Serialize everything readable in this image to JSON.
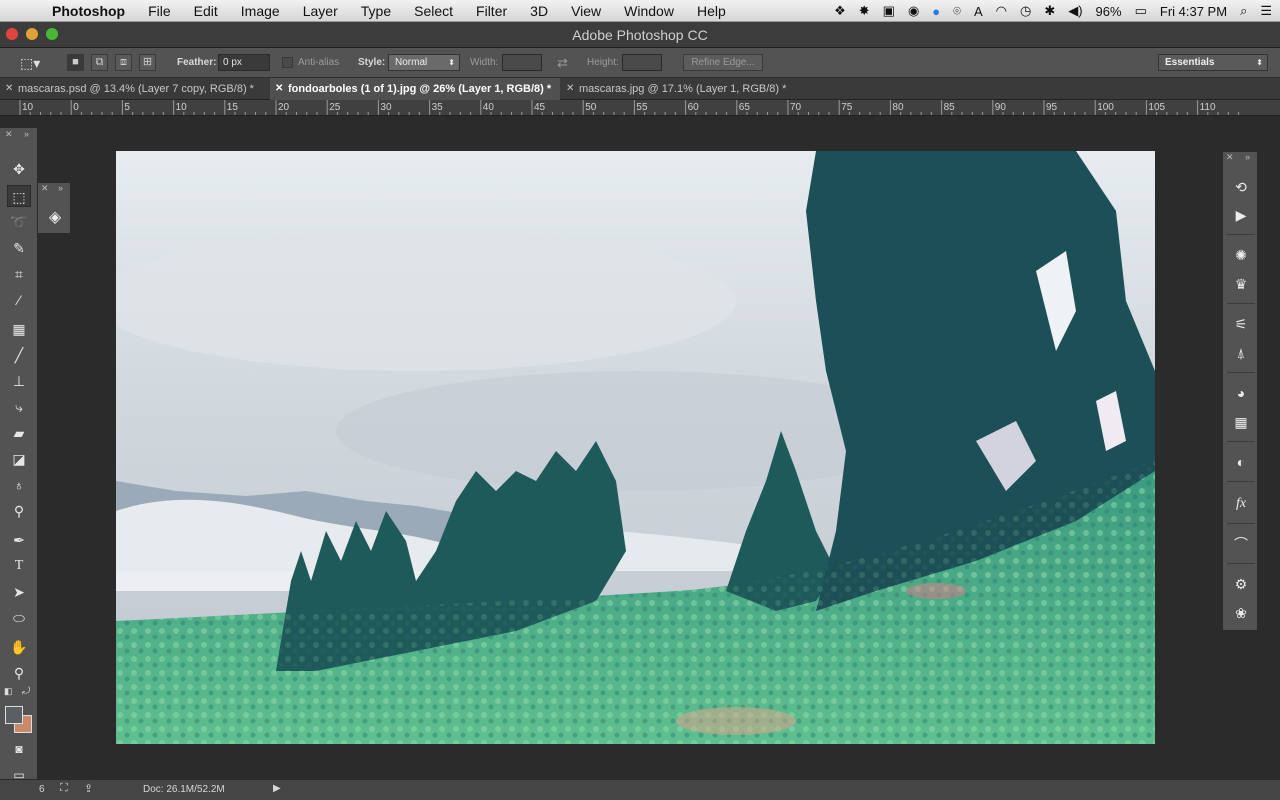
{
  "menubar": {
    "app": "Photoshop",
    "items": [
      "File",
      "Edit",
      "Image",
      "Layer",
      "Type",
      "Select",
      "Filter",
      "3D",
      "View",
      "Window",
      "Help"
    ],
    "battery": "96%",
    "clock": "Fri 4:37 PM"
  },
  "window": {
    "title": "Adobe Photoshop CC"
  },
  "options": {
    "feather_label": "Feather:",
    "feather_value": "0 px",
    "antialias_label": "Anti-alias",
    "style_label": "Style:",
    "style_value": "Normal",
    "width_label": "Width:",
    "height_label": "Height:",
    "refine_label": "Refine Edge...",
    "workspace": "Essentials"
  },
  "tabs": [
    {
      "label": "mascaras.psd @ 13.4% (Layer 7 copy, RGB/8) *",
      "active": false
    },
    {
      "label": "fondoarboles (1 of 1).jpg @ 26% (Layer 1, RGB/8) *",
      "active": true
    },
    {
      "label": "mascaras.jpg @ 17.1% (Layer 1, RGB/8) *",
      "active": false
    }
  ],
  "ruler": {
    "labels": [
      "10",
      "0",
      "5",
      "10",
      "15",
      "20",
      "25",
      "30",
      "35",
      "40",
      "45",
      "50",
      "55",
      "60",
      "65",
      "70",
      "75",
      "80",
      "85",
      "90",
      "95",
      "100",
      "105",
      "110"
    ]
  },
  "status": {
    "doc": "Doc: 26.1M/52.2M",
    "zoom": "6"
  },
  "colors": {
    "foreground": "#5a5f63",
    "background": "#c98a6a"
  }
}
